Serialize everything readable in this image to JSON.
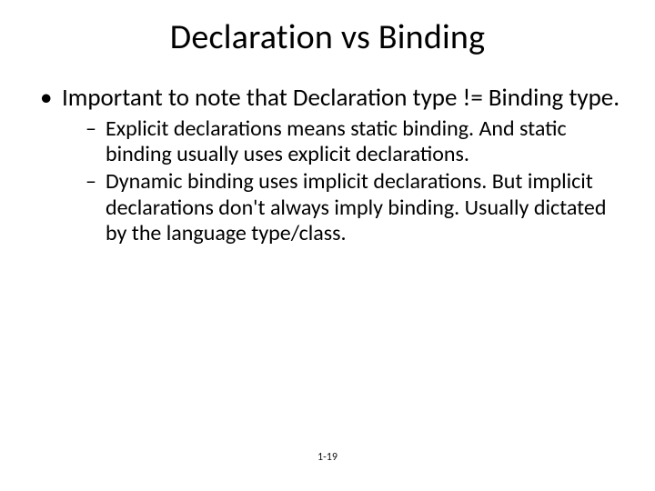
{
  "slide": {
    "title": "Declaration vs Binding",
    "bullets": [
      {
        "text": "Important to note that Declaration type != Binding type.",
        "sub": [
          "Explicit declarations means static binding.  And static binding usually uses explicit declarations.",
          "Dynamic binding uses implicit declarations. But implicit declarations don't always imply binding. Usually dictated by the language type/class."
        ]
      }
    ],
    "footer": "1-19"
  }
}
